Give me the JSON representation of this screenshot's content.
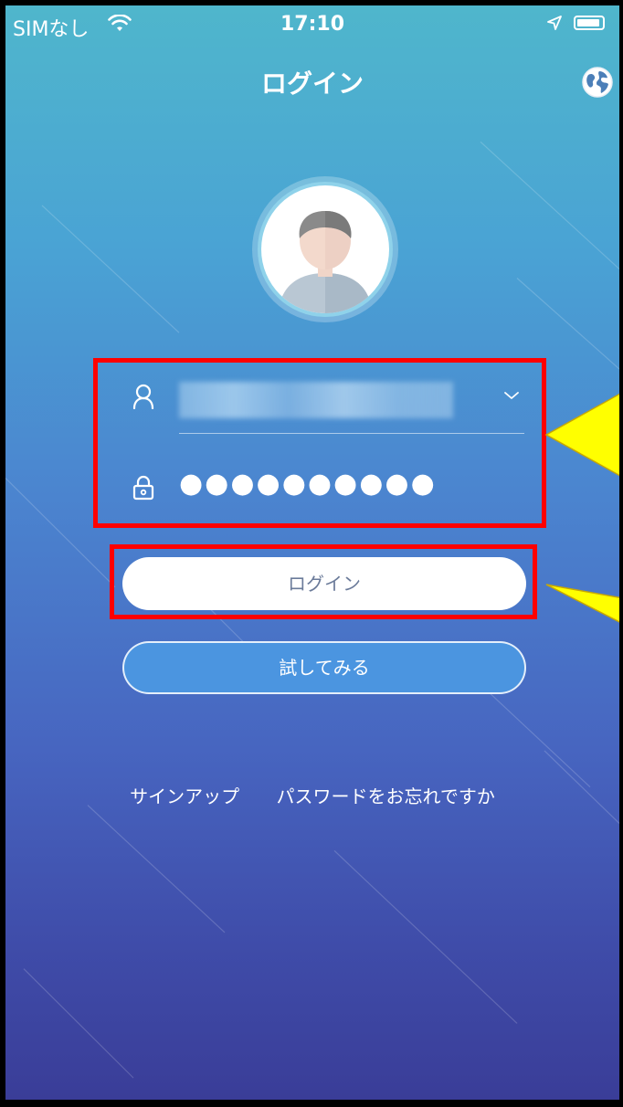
{
  "status_bar": {
    "carrier": "SIMなし",
    "time": "17:10"
  },
  "nav": {
    "title": "ログイン"
  },
  "login_form": {
    "username_value": "",
    "password_value": "●●●●●●●●●●",
    "login_button": "ログイン",
    "try_button": "試してみる"
  },
  "links": {
    "signup": "サインアップ",
    "forgot_password": "パスワードをお忘れですか"
  },
  "colors": {
    "annotation_border": "#ff0000",
    "callout_fill": "#ffff00",
    "background_top": "#4fb6cc",
    "background_bottom": "#3a3d98"
  },
  "icons": [
    "wifi-icon",
    "location-arrow-icon",
    "battery-icon",
    "globe-icon",
    "avatar-icon",
    "user-icon",
    "chevron-down-icon",
    "lock-icon"
  ]
}
